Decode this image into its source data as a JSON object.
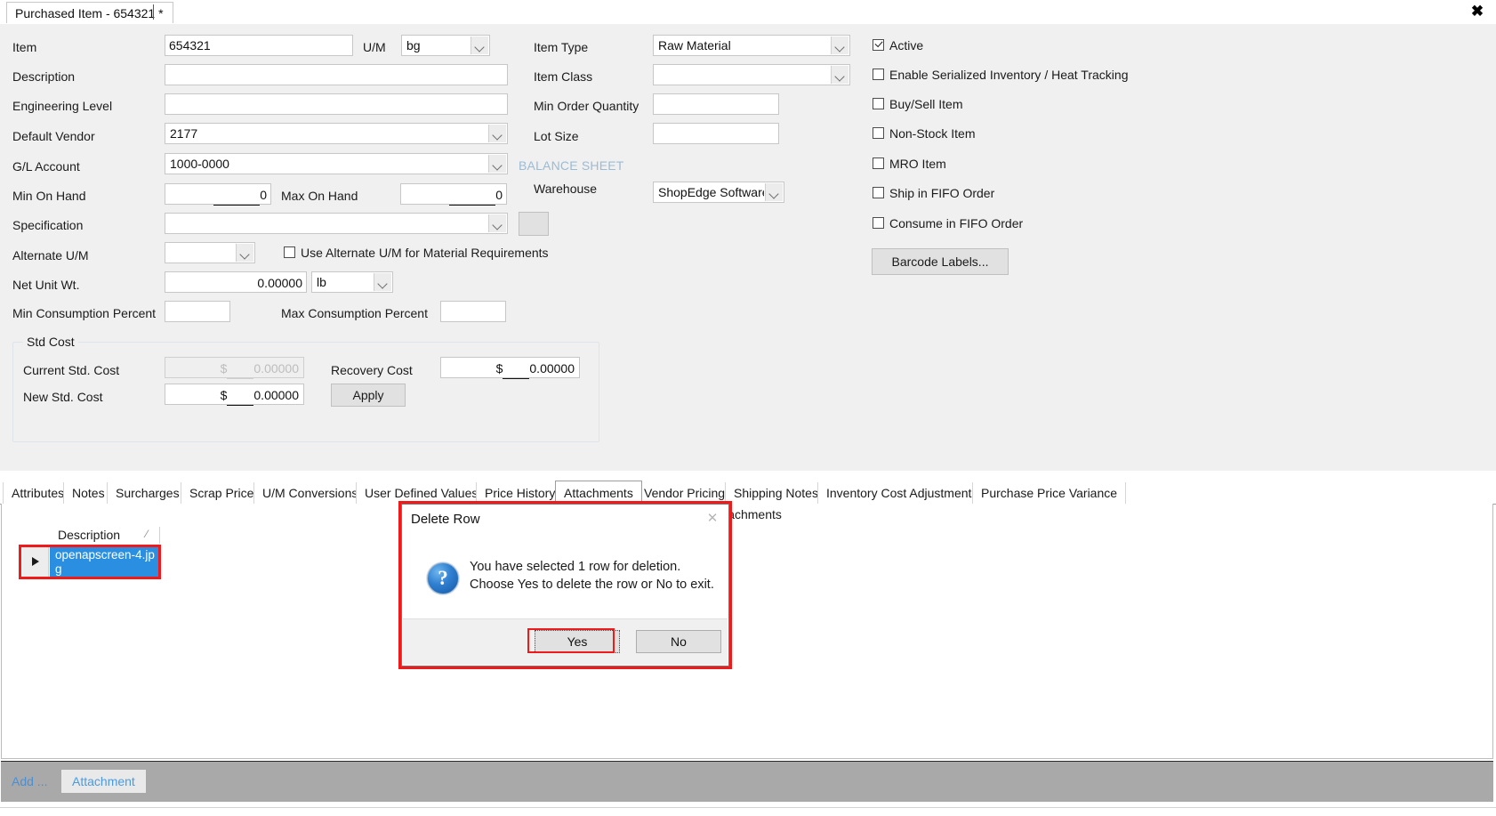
{
  "window": {
    "tab_title": "Purchased Item - 654321 *",
    "close_label": "✖"
  },
  "form": {
    "labels": {
      "item": "Item",
      "um": "U/M",
      "description": "Description",
      "engineering_level": "Engineering Level",
      "default_vendor": "Default Vendor",
      "gl_account": "G/L Account",
      "min_on_hand": "Min On Hand",
      "max_on_hand": "Max On Hand",
      "specification": "Specification",
      "alternate_um": "Alternate U/M",
      "use_alternate_um": "Use Alternate U/M for Material Requirements",
      "net_unit_wt": "Net Unit Wt.",
      "min_consumption_percent": "Min Consumption Percent",
      "max_consumption_percent": "Max Consumption Percent",
      "item_type": "Item Type",
      "item_class": "Item Class",
      "min_order_quantity": "Min Order Quantity",
      "lot_size": "Lot Size",
      "balance_sheet": "BALANCE SHEET",
      "warehouse": "Warehouse"
    },
    "values": {
      "item": "654321",
      "um": "bg",
      "description": "",
      "engineering_level": "",
      "default_vendor": "2177",
      "gl_account": "1000-0000",
      "min_on_hand": "0",
      "max_on_hand": "0",
      "specification": "",
      "alternate_um": "",
      "net_unit_wt": "0.00000",
      "net_unit_wt_um": "lb",
      "min_consumption_percent": "",
      "max_consumption_percent": "",
      "item_type": "Raw Material",
      "item_class": "",
      "min_order_quantity": "",
      "lot_size": "",
      "warehouse": "ShopEdge Software"
    },
    "checkboxes": [
      {
        "label": "Active",
        "checked": true
      },
      {
        "label": "Enable Serialized Inventory / Heat Tracking",
        "checked": false
      },
      {
        "label": "Buy/Sell Item",
        "checked": false
      },
      {
        "label": "Non-Stock Item",
        "checked": false
      },
      {
        "label": "MRO Item",
        "checked": false
      },
      {
        "label": "Ship in FIFO Order",
        "checked": false
      },
      {
        "label": "Consume in FIFO Order",
        "checked": false
      }
    ],
    "use_alternate_um_checked": false,
    "barcode_button": "Barcode Labels...",
    "std_cost": {
      "group_title": "Std Cost",
      "current_label": "Current Std. Cost",
      "current_value": "0.00000",
      "new_label": "New Std. Cost",
      "new_value": "0.00000",
      "recovery_label": "Recovery Cost",
      "recovery_value": "0.00000",
      "apply_button": "Apply",
      "currency": "$"
    }
  },
  "detail_tabs": [
    {
      "label": "Attributes",
      "selected": false
    },
    {
      "label": "Notes",
      "selected": false
    },
    {
      "label": "Surcharges",
      "selected": false
    },
    {
      "label": "Scrap Price",
      "selected": false
    },
    {
      "label": "U/M Conversions",
      "selected": false
    },
    {
      "label": "User Defined Values",
      "selected": false
    },
    {
      "label": "Price History",
      "selected": false
    },
    {
      "label": "Attachments",
      "selected": true
    },
    {
      "label": "Vendor Pricing",
      "selected": false
    },
    {
      "label": "Shipping Notes",
      "selected": false
    },
    {
      "label": "Inventory Cost Adjustments",
      "selected": false
    },
    {
      "label": "Purchase Price Variance",
      "selected": false
    }
  ],
  "attachments_pane": {
    "title": "Attachments",
    "column_header": "Description",
    "sort_indicator": "⁄",
    "rows": [
      {
        "description": "openapscreen-4.jpg",
        "selected": true
      }
    ]
  },
  "action_bar": {
    "add_link": "Add ...",
    "attachment_button": "Attachment"
  },
  "dialog": {
    "title": "Delete Row",
    "close_label": "✕",
    "icon": "question-icon",
    "message_line1": "You have selected 1 row for deletion.",
    "message_line2": "Choose Yes to delete the row or No to exit.",
    "yes_button": "Yes",
    "no_button": "No"
  },
  "colors": {
    "selection_blue": "#2a8fe0",
    "highlight_red": "#f01a1a",
    "form_background": "#f0f0f0",
    "action_bar": "#a9a9a9",
    "link_blue": "#4a8fd4"
  }
}
